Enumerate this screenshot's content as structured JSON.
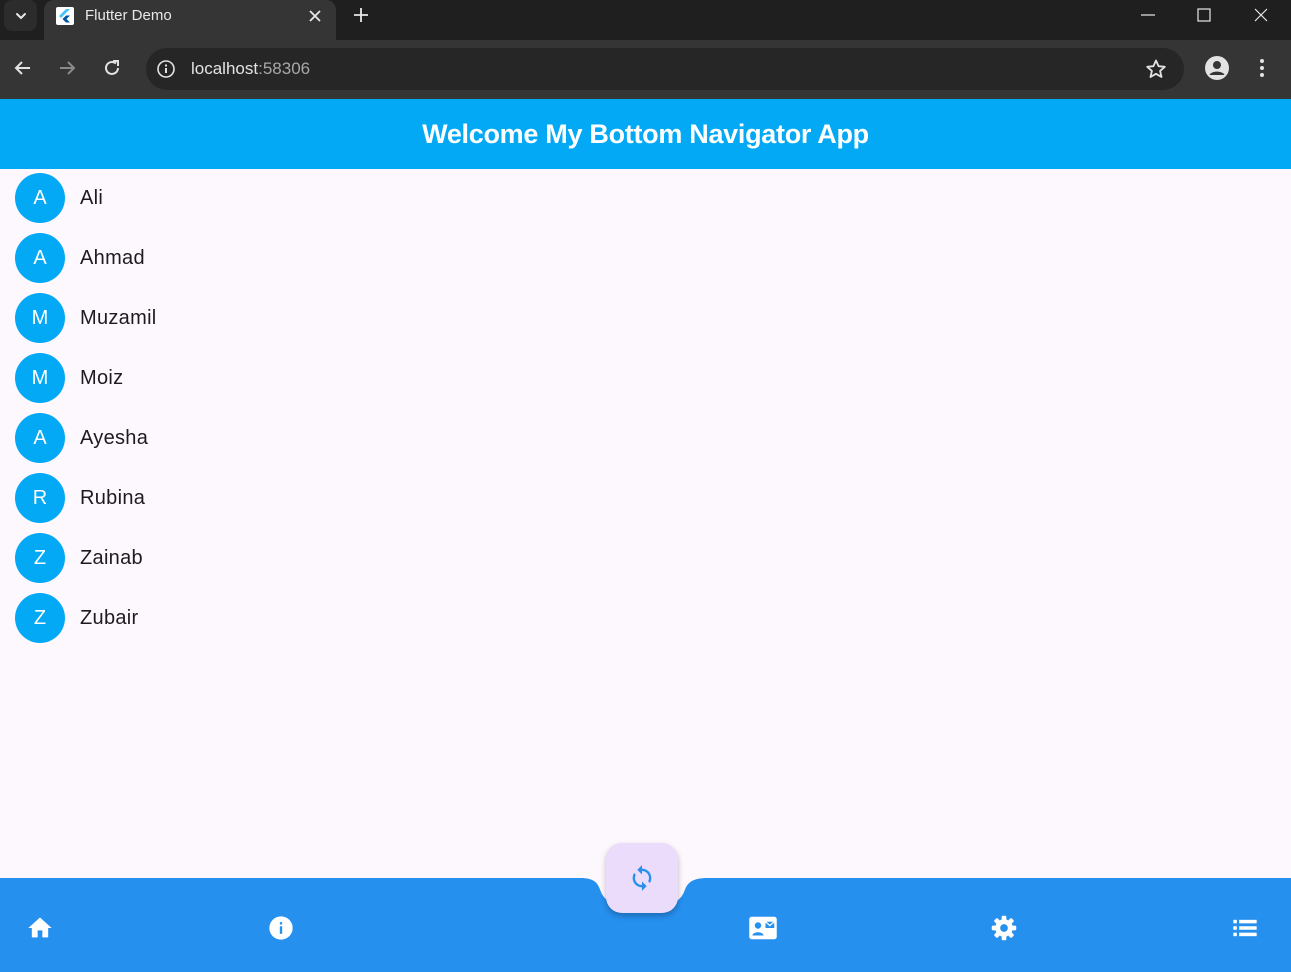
{
  "browser": {
    "tab_title": "Flutter Demo",
    "url_host": "localhost",
    "url_port": ":58306"
  },
  "app": {
    "title": "Welcome My Bottom Navigator App",
    "primary_color": "#03a9f4",
    "bottom_bar_color": "#2690ef"
  },
  "contacts": [
    {
      "initial": "A",
      "name": "Ali"
    },
    {
      "initial": "A",
      "name": "Ahmad"
    },
    {
      "initial": "M",
      "name": "Muzamil"
    },
    {
      "initial": "M",
      "name": "Moiz"
    },
    {
      "initial": "A",
      "name": "Ayesha"
    },
    {
      "initial": "R",
      "name": "Rubina"
    },
    {
      "initial": "Z",
      "name": "Zainab"
    },
    {
      "initial": "Z",
      "name": "Zubair"
    }
  ],
  "bottom_nav": {
    "items": [
      {
        "icon": "home-icon"
      },
      {
        "icon": "info-icon"
      },
      {
        "icon": "contact-mail-icon"
      },
      {
        "icon": "settings-icon"
      },
      {
        "icon": "list-icon"
      }
    ],
    "fab_icon": "sync-icon"
  }
}
